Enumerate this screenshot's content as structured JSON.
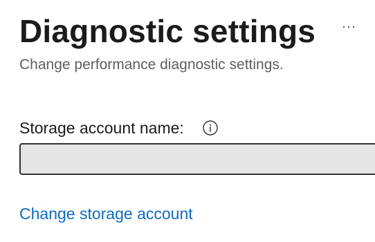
{
  "header": {
    "title": "Diagnostic settings",
    "subtitle": "Change performance diagnostic settings.",
    "more_icon": "ellipsis-icon",
    "more_label": "···"
  },
  "form": {
    "storage_account_label": "Storage account name:",
    "info_icon": "info-icon",
    "storage_account_value": "",
    "storage_account_placeholder": "",
    "change_link": "Change storage account"
  },
  "colors": {
    "link": "#0f6cbd",
    "input_background": "#e6e6e6",
    "input_border": "#323130",
    "subtitle": "#605e5c"
  }
}
